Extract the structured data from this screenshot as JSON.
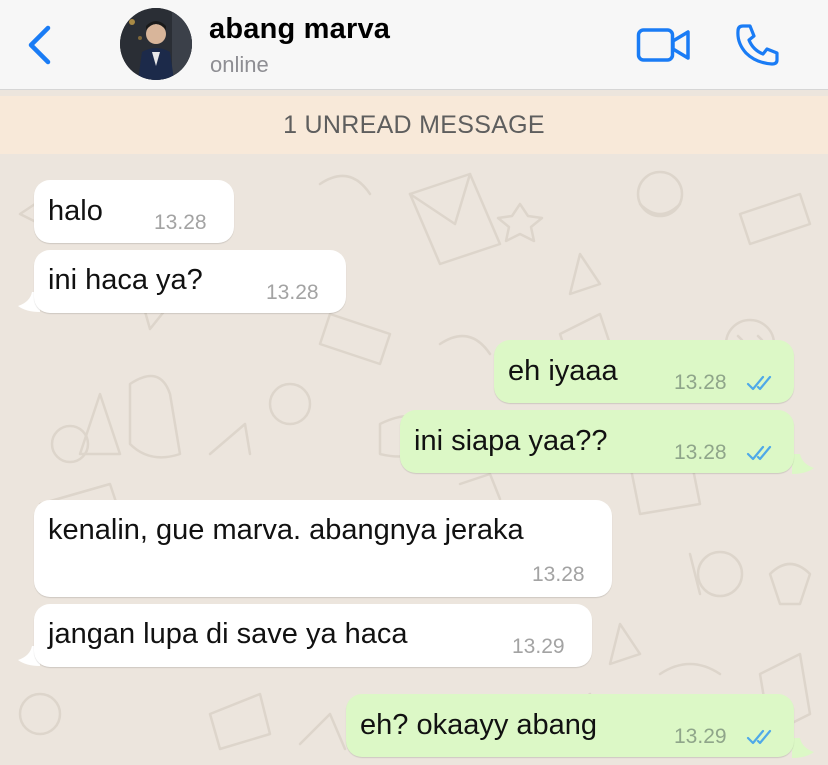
{
  "header": {
    "contact_name": "abang marva",
    "status": "online",
    "icons": {
      "back": "chevron-left-icon",
      "video": "video-camera-icon",
      "call": "phone-icon"
    },
    "accent_color": "#1a7cf5"
  },
  "banner": {
    "unread_text": "1 UNREAD MESSAGE"
  },
  "messages": [
    {
      "direction": "incoming",
      "text": "halo",
      "time": "13.28"
    },
    {
      "direction": "incoming",
      "text": "ini haca ya?",
      "time": "13.28"
    },
    {
      "direction": "outgoing",
      "text": "eh iyaaa",
      "time": "13.28",
      "status": "read"
    },
    {
      "direction": "outgoing",
      "text": "ini siapa yaa??",
      "time": "13.28",
      "status": "read"
    },
    {
      "direction": "incoming",
      "text": "kenalin, gue marva. abangnya jeraka",
      "time": "13.28"
    },
    {
      "direction": "incoming",
      "text": "jangan lupa di save ya haca",
      "time": "13.29"
    },
    {
      "direction": "outgoing",
      "text": "eh? okaayy abang",
      "time": "13.29",
      "status": "read"
    }
  ],
  "colors": {
    "incoming_bubble": "#ffffff",
    "outgoing_bubble": "#dcf8c6",
    "chat_background": "#ece5dd",
    "banner_background": "#f8e9d9",
    "read_ticks": "#4fa9e8"
  }
}
